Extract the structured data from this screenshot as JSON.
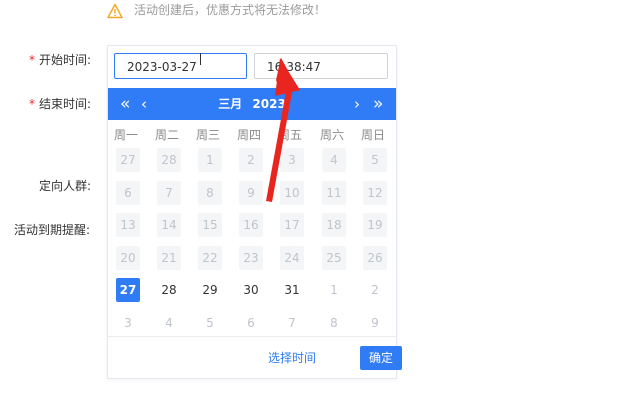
{
  "notice": {
    "icon": "warning-triangle-icon",
    "text": "活动创建后，优惠方式将无法修改！"
  },
  "form": {
    "required_mark": "*",
    "start_label": "开始时间:",
    "end_label": "结束时间:",
    "audience_label": "定向人群:",
    "reminder_label": "活动到期提醒:"
  },
  "picker": {
    "date_value": "2023-03-27",
    "time_value": "16:38:47",
    "month": "三月",
    "year": "2023",
    "weekdays": [
      "周一",
      "周二",
      "周三",
      "周四",
      "周五",
      "周六",
      "周日"
    ],
    "days": [
      [
        "27",
        "28",
        "1",
        "2",
        "3",
        "4",
        "5"
      ],
      [
        "6",
        "7",
        "8",
        "9",
        "10",
        "11",
        "12"
      ],
      [
        "13",
        "14",
        "15",
        "16",
        "17",
        "18",
        "19"
      ],
      [
        "20",
        "21",
        "22",
        "23",
        "24",
        "25",
        "26"
      ],
      [
        "27",
        "28",
        "29",
        "30",
        "31",
        "1",
        "2"
      ],
      [
        "3",
        "4",
        "5",
        "6",
        "7",
        "8",
        "9"
      ]
    ],
    "day_states": [
      [
        "disabled",
        "disabled",
        "disabled",
        "disabled",
        "disabled",
        "disabled",
        "disabled"
      ],
      [
        "disabled",
        "disabled",
        "disabled",
        "disabled",
        "disabled",
        "disabled",
        "disabled"
      ],
      [
        "disabled",
        "disabled",
        "disabled",
        "disabled",
        "disabled",
        "disabled",
        "disabled"
      ],
      [
        "disabled",
        "disabled",
        "disabled",
        "disabled",
        "disabled",
        "disabled",
        "disabled"
      ],
      [
        "selected",
        "normal",
        "normal",
        "normal",
        "normal",
        "muted",
        "muted"
      ],
      [
        "muted",
        "muted",
        "muted",
        "muted",
        "muted",
        "muted",
        "muted"
      ]
    ],
    "select_time_label": "选择时间",
    "confirm_label": "确定"
  },
  "colors": {
    "accent": "#2f7cf6",
    "required": "#f5222d",
    "warning": "#f5a623",
    "annotation_arrow": "#e8261f"
  }
}
